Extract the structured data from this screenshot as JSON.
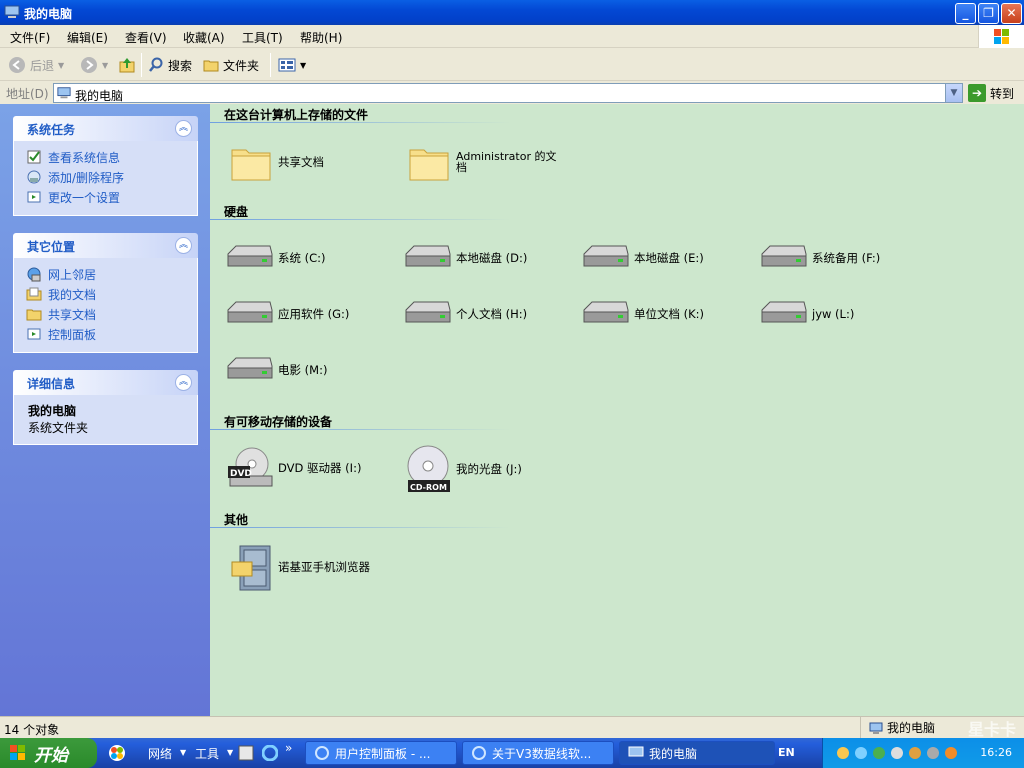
{
  "window": {
    "title": "我的电脑",
    "min_label": "_",
    "max_label": "❐",
    "close_label": "✕"
  },
  "menu": [
    "文件(F)",
    "编辑(E)",
    "查看(V)",
    "收藏(A)",
    "工具(T)",
    "帮助(H)"
  ],
  "toolbar": {
    "back": "后退",
    "search": "搜索",
    "folders": "文件夹"
  },
  "address": {
    "label": "地址(D)",
    "value": "我的电脑",
    "go": "转到"
  },
  "left_panels": [
    {
      "title": "系统任务",
      "links": [
        {
          "label": "查看系统信息",
          "icon": "system-info-icon"
        },
        {
          "label": "添加/删除程序",
          "icon": "add-remove-programs-icon"
        },
        {
          "label": "更改一个设置",
          "icon": "control-panel-icon"
        }
      ]
    },
    {
      "title": "其它位置",
      "links": [
        {
          "label": "网上邻居",
          "icon": "network-icon"
        },
        {
          "label": "我的文档",
          "icon": "documents-icon"
        },
        {
          "label": "共享文档",
          "icon": "shared-folder-icon"
        },
        {
          "label": "控制面板",
          "icon": "control-panel-icon"
        }
      ]
    },
    {
      "title": "详细信息",
      "detail_title": "我的电脑",
      "detail_sub": "系统文件夹"
    }
  ],
  "sections": {
    "files": "在这台计算机上存储的文件",
    "disks": "硬盘",
    "removable": "有可移动存储的设备",
    "other": "其他"
  },
  "files": [
    "共享文档",
    "Administrator 的文\n档"
  ],
  "disks": [
    "系统 (C:)",
    "本地磁盘 (D:)",
    "本地磁盘 (E:)",
    "系统备用 (F:)",
    "应用软件 (G:)",
    "个人文档 (H:)",
    "单位文档 (K:)",
    "jyw (L:)",
    "电影 (M:)"
  ],
  "removable": [
    {
      "label": "DVD 驱动器 (I:)",
      "badge": "DVD"
    },
    {
      "label": "我的光盘 (J:)",
      "badge": "CD-ROM"
    }
  ],
  "other": [
    "诺基亚手机浏览器"
  ],
  "status": {
    "count": "14 个对象",
    "location": "我的电脑"
  },
  "taskbar": {
    "start": "开始",
    "quick": [
      "网络",
      "工具"
    ],
    "buttons": [
      "用户控制面板 - ...",
      "关于V3数据线软...",
      "我的电脑"
    ],
    "lang": "EN",
    "clock": "16:26"
  },
  "watermark": "星卡卡"
}
